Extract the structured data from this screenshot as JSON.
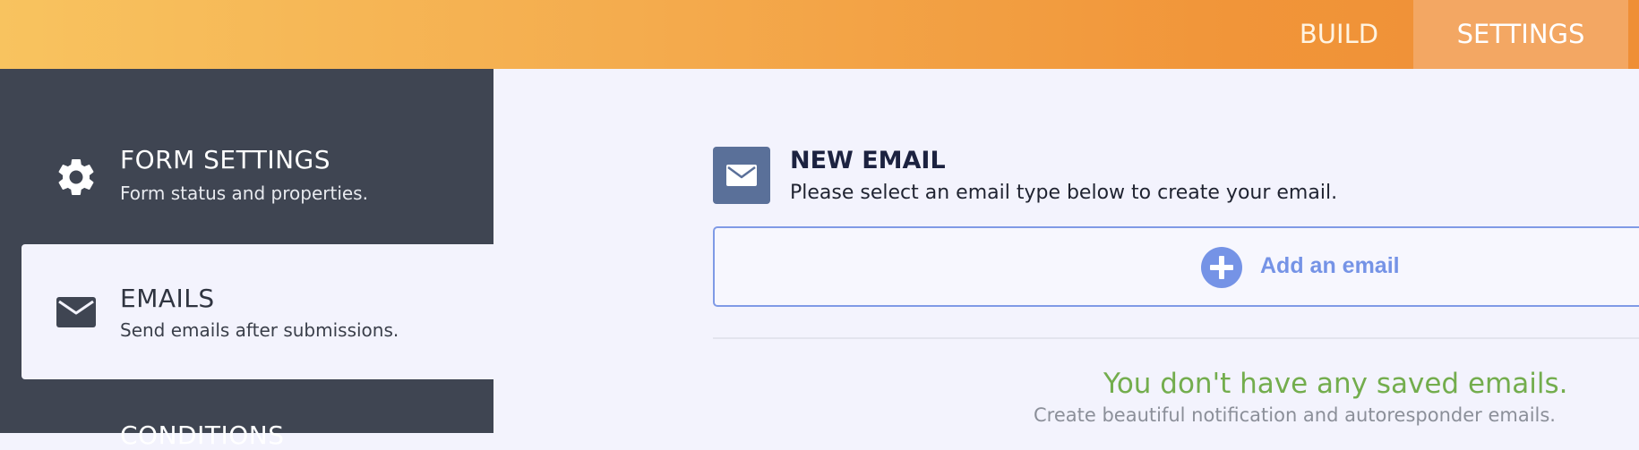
{
  "topnav": {
    "tabs": [
      {
        "label": "BUILD",
        "active": false
      },
      {
        "label": "SETTINGS",
        "active": true
      }
    ]
  },
  "sidebar": {
    "items": [
      {
        "title": "FORM SETTINGS",
        "subtitle": "Form status and properties.",
        "icon": "gear-icon",
        "active": false
      },
      {
        "title": "EMAILS",
        "subtitle": "Send emails after submissions.",
        "icon": "envelope-icon",
        "active": true
      },
      {
        "title": "CONDITIONS",
        "subtitle": "",
        "icon": "",
        "active": false
      }
    ]
  },
  "main": {
    "new_email": {
      "title": "NEW EMAIL",
      "description": "Please select an email type below to create your email.",
      "icon": "envelope-icon"
    },
    "add_email_label": "Add an email",
    "empty_state": {
      "title": "You don't have any saved emails.",
      "subtitle": "Create beautiful notification and autoresponder emails."
    }
  },
  "colors": {
    "accent_orange": "#f19539",
    "sidebar_bg": "#3f4552",
    "page_bg": "#f3f3fd",
    "add_blue": "#7593e6",
    "empty_green": "#73ad4d"
  }
}
